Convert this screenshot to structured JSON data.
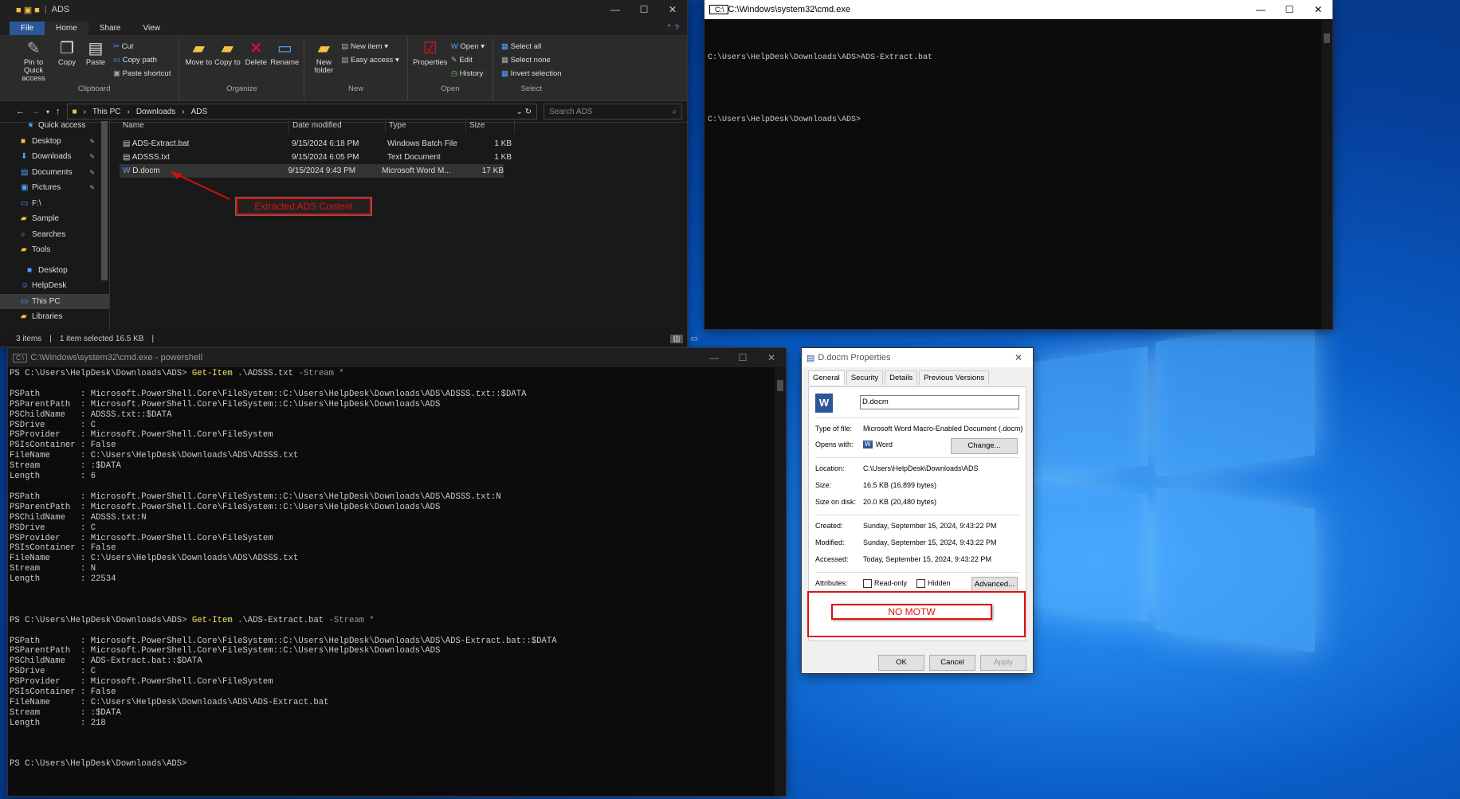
{
  "explorer": {
    "title": "ADS",
    "tabs": [
      "File",
      "Home",
      "Share",
      "View"
    ],
    "ribbon": {
      "clipboard": {
        "name": "Clipboard",
        "pin": "Pin to Quick access",
        "copy": "Copy",
        "paste": "Paste",
        "cut": "Cut",
        "copy_path": "Copy path",
        "paste_shortcut": "Paste shortcut"
      },
      "organize": {
        "name": "Organize",
        "move": "Move to",
        "copy": "Copy to",
        "delete": "Delete",
        "rename": "Rename"
      },
      "new": {
        "name": "New",
        "folder": "New folder",
        "item": "New item",
        "easy": "Easy access"
      },
      "open": {
        "name": "Open",
        "properties": "Properties",
        "open": "Open",
        "edit": "Edit",
        "history": "History"
      },
      "select": {
        "name": "Select",
        "all": "Select all",
        "none": "Select none",
        "invert": "Invert selection"
      }
    },
    "address": {
      "parts": [
        "This PC",
        "Downloads",
        "ADS"
      ],
      "search_placeholder": "Search ADS"
    },
    "nav": [
      {
        "label": "Quick access",
        "icon": "★"
      },
      {
        "label": "Desktop",
        "icon": "■",
        "pin": true
      },
      {
        "label": "Downloads",
        "icon": "⬇",
        "pin": true
      },
      {
        "label": "Documents",
        "icon": "▤",
        "pin": true
      },
      {
        "label": "Pictures",
        "icon": "▣",
        "pin": true
      },
      {
        "label": "F:\\",
        "icon": "▭"
      },
      {
        "label": "Sample",
        "icon": "▰"
      },
      {
        "label": "Searches",
        "icon": "⌕"
      },
      {
        "label": "Tools",
        "icon": "▰"
      },
      {
        "label": "Desktop",
        "icon": "■"
      },
      {
        "label": "HelpDesk",
        "icon": "☺"
      },
      {
        "label": "This PC",
        "icon": "▭"
      },
      {
        "label": "Libraries",
        "icon": "▰"
      }
    ],
    "columns": [
      "Name",
      "Date modified",
      "Type",
      "Size"
    ],
    "files": [
      {
        "name": "ADS-Extract.bat",
        "date": "9/15/2024 6:18 PM",
        "type": "Windows Batch File",
        "size": "1 KB"
      },
      {
        "name": "ADSSS.txt",
        "date": "9/15/2024 6:05 PM",
        "type": "Text Document",
        "size": "1 KB"
      },
      {
        "name": "D.docm",
        "date": "9/15/2024 9:43 PM",
        "type": "Microsoft Word M...",
        "size": "17 KB"
      }
    ],
    "annotation": "Extracted ADS Content",
    "status": {
      "items": "3 items",
      "selected": "1 item selected  16.5 KB"
    }
  },
  "cmd": {
    "title": "C:\\Windows\\system32\\cmd.exe",
    "lines": [
      "C:\\Users\\HelpDesk\\Downloads\\ADS>ADS-Extract.bat",
      "",
      "C:\\Users\\HelpDesk\\Downloads\\ADS>"
    ]
  },
  "ps": {
    "title": "C:\\Windows\\system32\\cmd.exe - powershell",
    "prompt1": "PS C:\\Users\\HelpDesk\\Downloads\\ADS> ",
    "cmd1": "Get-Item",
    "arg1": " .\\ADSSS.txt ",
    "param1": "-Stream",
    "star": " *",
    "block1": "\n\nPSPath        : Microsoft.PowerShell.Core\\FileSystem::C:\\Users\\HelpDesk\\Downloads\\ADS\\ADSSS.txt::$DATA\nPSParentPath  : Microsoft.PowerShell.Core\\FileSystem::C:\\Users\\HelpDesk\\Downloads\\ADS\nPSChildName   : ADSSS.txt::$DATA\nPSDrive       : C\nPSProvider    : Microsoft.PowerShell.Core\\FileSystem\nPSIsContainer : False\nFileName      : C:\\Users\\HelpDesk\\Downloads\\ADS\\ADSSS.txt\nStream        : :$DATA\nLength        : 6\n\nPSPath        : Microsoft.PowerShell.Core\\FileSystem::C:\\Users\\HelpDesk\\Downloads\\ADS\\ADSSS.txt:N\nPSParentPath  : Microsoft.PowerShell.Core\\FileSystem::C:\\Users\\HelpDesk\\Downloads\\ADS\nPSChildName   : ADSSS.txt:N\nPSDrive       : C\nPSProvider    : Microsoft.PowerShell.Core\\FileSystem\nPSIsContainer : False\nFileName      : C:\\Users\\HelpDesk\\Downloads\\ADS\\ADSSS.txt\nStream        : N\nLength        : 22534\n\n\n\n",
    "prompt2": "PS C:\\Users\\HelpDesk\\Downloads\\ADS> ",
    "cmd2": "Get-Item",
    "arg2": " .\\ADS-Extract.bat ",
    "param2": "-Stream",
    "block2": "\n\nPSPath        : Microsoft.PowerShell.Core\\FileSystem::C:\\Users\\HelpDesk\\Downloads\\ADS\\ADS-Extract.bat::$DATA\nPSParentPath  : Microsoft.PowerShell.Core\\FileSystem::C:\\Users\\HelpDesk\\Downloads\\ADS\nPSChildName   : ADS-Extract.bat::$DATA\nPSDrive       : C\nPSProvider    : Microsoft.PowerShell.Core\\FileSystem\nPSIsContainer : False\nFileName      : C:\\Users\\HelpDesk\\Downloads\\ADS\\ADS-Extract.bat\nStream        : :$DATA\nLength        : 218\n\n\n\nPS C:\\Users\\HelpDesk\\Downloads\\ADS>"
  },
  "props": {
    "title": "D.docm Properties",
    "tabs": [
      "General",
      "Security",
      "Details",
      "Previous Versions"
    ],
    "filename": "D.docm",
    "type_label": "Type of file:",
    "type_value": "Microsoft Word Macro-Enabled Document (.docm)",
    "opens_label": "Opens with:",
    "opens_value": "Word",
    "change": "Change...",
    "location_label": "Location:",
    "location_value": "C:\\Users\\HelpDesk\\Downloads\\ADS",
    "size_label": "Size:",
    "size_value": "16.5 KB (16,899 bytes)",
    "disk_label": "Size on disk:",
    "disk_value": "20.0 KB (20,480 bytes)",
    "created_label": "Created:",
    "created_value": "Sunday, September 15, 2024, 9:43:22 PM",
    "modified_label": "Modified:",
    "modified_value": "Sunday, September 15, 2024, 9:43:22 PM",
    "accessed_label": "Accessed:",
    "accessed_value": "Today, September 15, 2024, 9:43:22 PM",
    "attr_label": "Attributes:",
    "readonly": "Read-only",
    "hidden": "Hidden",
    "advanced": "Advanced...",
    "annotation": "NO MOTW",
    "ok": "OK",
    "cancel": "Cancel",
    "apply": "Apply"
  },
  "colors": {
    "accent": "#2b5797",
    "annotation": "#e01010",
    "ps_keyword": "#f2e56b"
  }
}
